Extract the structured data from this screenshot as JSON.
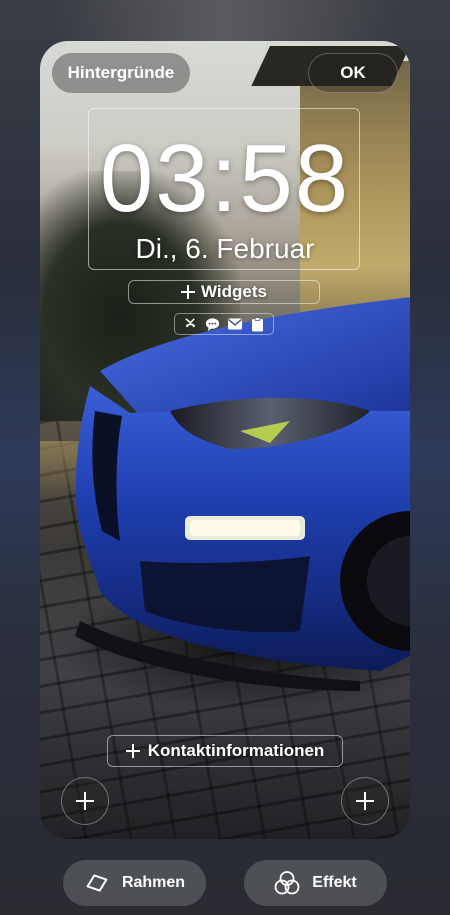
{
  "header": {
    "wallpapers_label": "Hintergründe",
    "ok_label": "OK"
  },
  "lockscreen": {
    "time": "03:58",
    "date": "Di., 6. Februar",
    "widgets_label": "Widgets",
    "contact_info_label": "Kontaktinformationen",
    "notification_icons": [
      "missed-call-icon",
      "chat-bubble-icon",
      "mail-icon",
      "clipboard-icon"
    ],
    "left_shortcut_icon": "plus-icon",
    "right_shortcut_icon": "plus-icon"
  },
  "bottom_bar": {
    "frame_label": "Rahmen",
    "frame_icon": "frame-icon",
    "effect_label": "Effekt",
    "effect_icon": "effect-circles-icon"
  },
  "colors": {
    "car_blue": "#1f3fb0",
    "button_gray": "#7a7a7a",
    "text": "#ffffff"
  }
}
